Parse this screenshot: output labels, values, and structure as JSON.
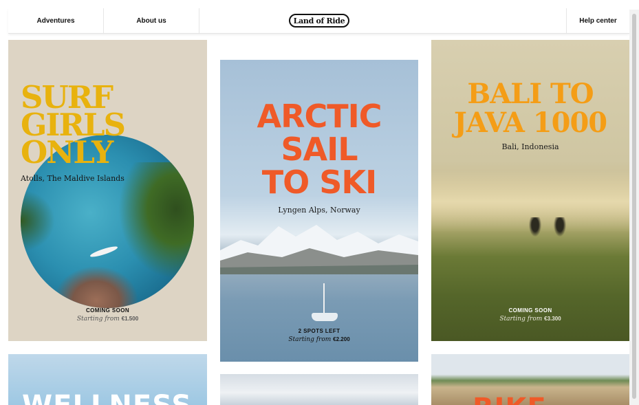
{
  "header": {
    "nav_left": [
      "Adventures",
      "About us"
    ],
    "logo_text": "Land of Ride",
    "help_label": "Help center"
  },
  "cards": [
    {
      "title": "SURF\nGIRLS\nONLY",
      "location": "Atolls, The Maldive Islands",
      "status": "COMING SOON",
      "price_prefix": "Starting from",
      "price": "€1.500",
      "title_color": "#e8b20e"
    },
    {
      "title": "ARCTIC\nSAIL\nTO SKI",
      "location": "Lyngen Alps, Norway",
      "status": "2 SPOTS LEFT",
      "price_prefix": "Starting from",
      "price": "€2.200",
      "title_color": "#ef5a28"
    },
    {
      "title": "BALI TO\nJAVA 1000",
      "location": "Bali, Indonesia",
      "status": "COMING SOON",
      "price_prefix": "Starting from",
      "price": "€3.300",
      "title_color": "#f49d16"
    }
  ],
  "peek_cards": [
    {
      "title": "WELLNESS"
    },
    {
      "title": ""
    },
    {
      "title": "BIKE"
    }
  ]
}
